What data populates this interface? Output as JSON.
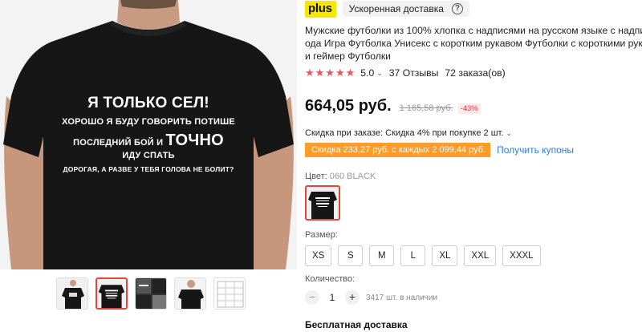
{
  "product": {
    "print_lines": {
      "line1": "Я ТОЛЬКО СЕЛ!",
      "line2": "ХОРОШО Я БУДУ ГОВОРИТЬ ПОТИШЕ",
      "line3a": "ПОСЛЕДНИЙ БОЙ И",
      "line3b": "ТОЧНО",
      "line4": "ИДУ СПАТЬ",
      "line5": "ДОРОГАЯ, А РАЗВЕ У ТЕБЯ ГОЛОВА НЕ БОЛИТ?"
    },
    "thumbnails": [
      "front-view",
      "back-print-selected",
      "collage",
      "model-front",
      "size-chart"
    ]
  },
  "header": {
    "plus_label": "plus",
    "delivery_label": "Ускоренная доставка",
    "help_label": "?"
  },
  "title_lines": [
    "Мужские футболки из 100% хлопка с надписями на русском языке с надписью м",
    "ода Игра Футболка Унисекс с коротким рукавом Футболки с короткими рукавам",
    "и геймер Футболки"
  ],
  "rating": {
    "stars": "★★★★★",
    "value": "5.0",
    "reviews": "37 Отзывы",
    "orders": "72 заказа(ов)"
  },
  "price": {
    "current": "664,05 руб.",
    "old": "1 165,58 руб.",
    "discount": "-43%"
  },
  "order_discount": {
    "text": "Скидка при заказе: Скидка 4% при покупке 2 шт.",
    "coupon": "Скидка 233,27 руб. с каждых 2 099,44 руб.",
    "get_coupons": "Получить купоны"
  },
  "color": {
    "label": "Цвет: ",
    "value": "060 BLACK"
  },
  "size": {
    "label": "Размер:",
    "options": [
      "XS",
      "S",
      "M",
      "L",
      "XL",
      "XXL",
      "XXXL"
    ]
  },
  "quantity": {
    "label": "Количество:",
    "value": "1",
    "minus": "−",
    "plus": "+",
    "stock": "3417 шт. в наличии"
  },
  "shipping": {
    "label": "Бесплатная доставка"
  },
  "colors": {
    "accent": "#e0473a",
    "plus_yellow": "#f5e700",
    "star": "#f0525c",
    "coupon": "#ff9c2a",
    "link": "#2f7bd8"
  }
}
